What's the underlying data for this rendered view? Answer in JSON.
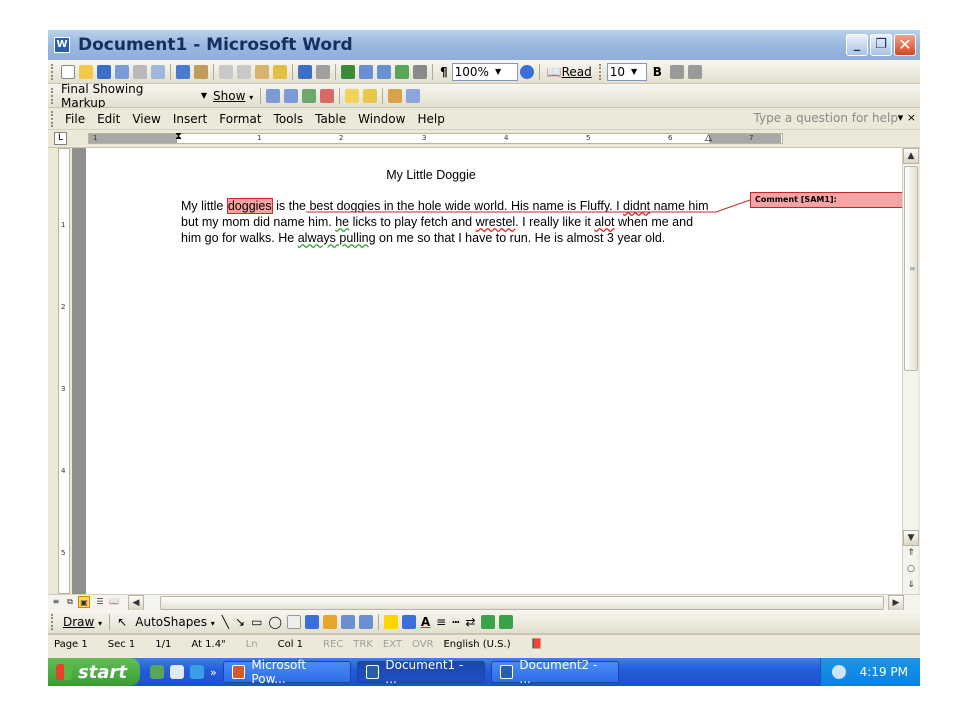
{
  "window": {
    "title": "Document1 - Microsoft Word",
    "buttons": [
      "_",
      "❐",
      "✕"
    ]
  },
  "standard_toolbar": {
    "zoom": "100%",
    "read_label": "Read",
    "font_size": "10",
    "bold": "B"
  },
  "review_toolbar": {
    "display_mode": "Final Showing Markup",
    "show_label": "Show"
  },
  "menu": {
    "items": [
      "File",
      "Edit",
      "View",
      "Insert",
      "Format",
      "Tools",
      "Table",
      "Window",
      "Help"
    ],
    "ask_placeholder": "Type a question for help",
    "close_x": "▾ ×"
  },
  "ruler": {
    "numbers": [
      "1",
      "1",
      "2",
      "3",
      "4",
      "5",
      "6",
      "7"
    ],
    "vnumbers": [
      "1",
      "2",
      "3",
      "4",
      "5"
    ]
  },
  "document": {
    "title": "My Little Doggie",
    "p_before": "My little ",
    "highlight": "doggies",
    "p_1": " is the best doggies in the hole wide world.  His name is Fluffy.  I ",
    "w_didnt": "didnt",
    "p_2": " name him but my mom did name him.  ",
    "w_he": "he",
    "p_3": " licks to play fetch and ",
    "w_wrestel": "wrestel",
    "p_4": ".  I really like it ",
    "w_alot": "alot",
    "p_5": " when me and him go for walks.  He ",
    "w_always": "always pulling",
    "p_6": " on me so that I have to run.  He is almost 3 year old."
  },
  "comment": {
    "label": "Comment [SAM1]:"
  },
  "drawing_toolbar": {
    "draw": "Draw",
    "autoshapes": "AutoShapes"
  },
  "statusbar": {
    "page": "Page 1",
    "sec": "Sec 1",
    "pages": "1/1",
    "at": "At 1.4\"",
    "ln": "Ln",
    "col": "Col 1",
    "rec": "REC",
    "trk": "TRK",
    "ext": "EXT",
    "ovr": "OVR",
    "lang": "English (U.S.)"
  },
  "taskbar": {
    "start": "start",
    "tasks": [
      "Microsoft Pow...",
      "Document1 - ...",
      "Document2 - ..."
    ],
    "clock": "4:19 PM"
  },
  "colors": {
    "comment_fill": "#f6a3a3",
    "comment_border": "#c1272d",
    "taskbar": "#245edb",
    "start": "#3a9c32"
  }
}
